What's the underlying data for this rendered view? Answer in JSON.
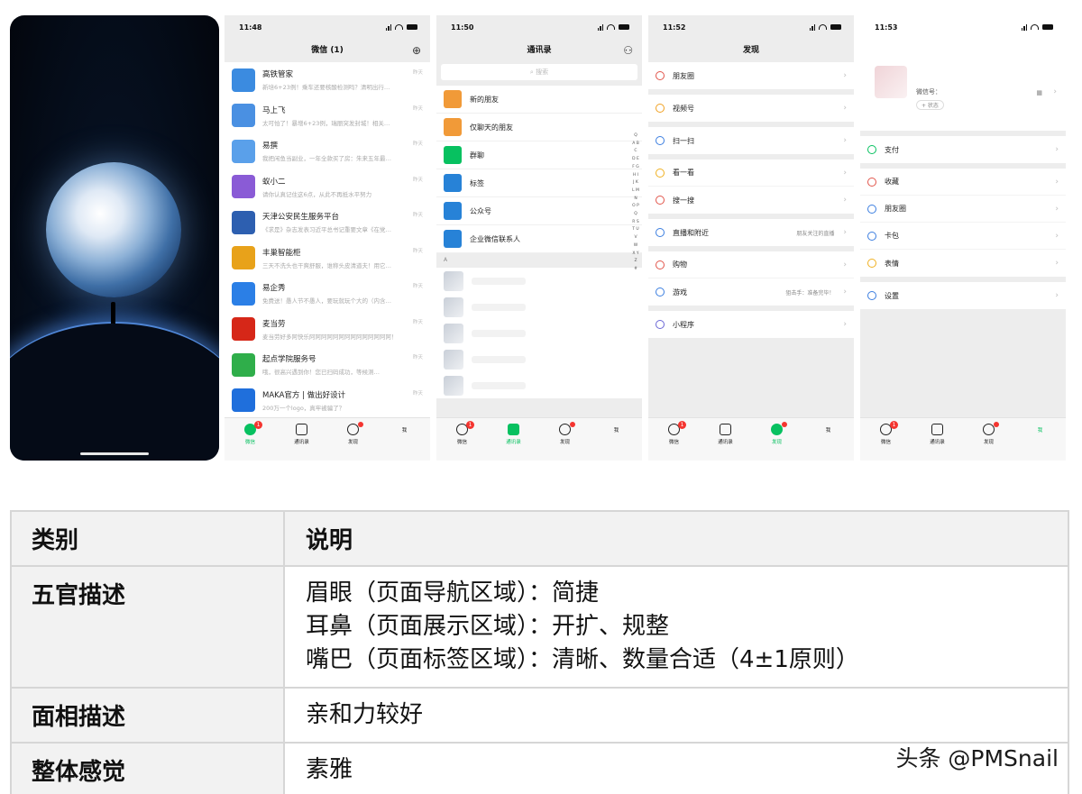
{
  "phone2": {
    "time": "11:48",
    "title": "微信 (1)",
    "chats": [
      {
        "name": "高铁管家",
        "msg": "新培6+23例！乘车还要核酸检测吗？清明出行…",
        "time": "昨天",
        "color": "#3b8be0"
      },
      {
        "name": "马上飞",
        "msg": "太可怕了！暴增6+23例，瑞丽突发封城！相关…",
        "time": "昨天",
        "color": "#4a90e2"
      },
      {
        "name": "易撰",
        "msg": "我把闲鱼当副业，一年全款买了房：朱来五年最…",
        "time": "昨天",
        "color": "#5aa0ea"
      },
      {
        "name": "蚁小二",
        "msg": "请你认真记住这6点，从此不再抵水平努力",
        "time": "昨天",
        "color": "#8a5bd6"
      },
      {
        "name": "天津公安民生服务平台",
        "msg": "《求是》杂志发表习近平总书记重要文章《在党…",
        "time": "昨天",
        "color": "#2d5fb0"
      },
      {
        "name": "丰巢智能柜",
        "msg": "三天不洗头也干爽舒服，谁称头皮清道夫！用它…",
        "time": "昨天",
        "color": "#e8a21a"
      },
      {
        "name": "易企秀",
        "msg": "免费送！愚人节不愚人，要玩就玩个大的（内含…",
        "time": "昨天",
        "color": "#2b7fe6"
      },
      {
        "name": "麦当劳",
        "msg": "麦当劳好多阿快乐阿阿阿阿阿阿阿阿阿阿阿阿阿阿！",
        "time": "昨天",
        "color": "#d62718"
      },
      {
        "name": "起点学院服务号",
        "msg": "哦，很高兴遇到你！您已扫码成功，等候测…",
        "time": "昨天",
        "color": "#2fae4a"
      },
      {
        "name": "MAKA官方 | 做出好设计",
        "msg": "200万一个logo，真牢被骗了？",
        "time": "昨天",
        "color": "#1f6fdc"
      }
    ],
    "tabs": [
      "微信",
      "通讯录",
      "发现",
      "我"
    ],
    "badge": "1"
  },
  "phone3": {
    "time": "11:50",
    "title": "通讯录",
    "search": "搜索",
    "items": [
      {
        "label": "新的朋友",
        "color": "#f19a38"
      },
      {
        "label": "仅聊天的朋友",
        "color": "#f19a38"
      },
      {
        "label": "群聊",
        "color": "#07c160"
      },
      {
        "label": "标签",
        "color": "#2782d7"
      },
      {
        "label": "公众号",
        "color": "#2782d7"
      },
      {
        "label": "企业微信联系人",
        "color": "#2782d7"
      }
    ],
    "section": "A",
    "alpha": "Q A B C D E F G H I J K L M N O P Q R S T U V W X Y Z #"
  },
  "phone4": {
    "time": "11:52",
    "title": "发现",
    "groups": [
      [
        {
          "label": "朋友圈",
          "extra": "",
          "color": "#e2554b"
        }
      ],
      [
        {
          "label": "视频号",
          "extra": "",
          "color": "#f0a020"
        }
      ],
      [
        {
          "label": "扫一扫",
          "extra": "",
          "color": "#3b7ee0"
        }
      ],
      [
        {
          "label": "看一看",
          "extra": "",
          "color": "#f0b020"
        },
        {
          "label": "搜一搜",
          "extra": "",
          "color": "#e2554b"
        }
      ],
      [
        {
          "label": "直播和附近",
          "extra": "朋友关注的直播",
          "color": "#3b7ee0"
        }
      ],
      [
        {
          "label": "购物",
          "extra": "",
          "color": "#e2554b"
        },
        {
          "label": "游戏",
          "extra": "狙击手：准备完毕！",
          "color": "#3b7ee0"
        }
      ],
      [
        {
          "label": "小程序",
          "extra": "",
          "color": "#6b67d6"
        }
      ]
    ]
  },
  "phone5": {
    "time": "11:53",
    "wxid": "微信号：",
    "status": "+ 状态",
    "groups": [
      [
        {
          "label": "支付",
          "color": "#07c160"
        }
      ],
      [
        {
          "label": "收藏",
          "color": "#e2554b"
        },
        {
          "label": "朋友圈",
          "color": "#3b7ee0"
        },
        {
          "label": "卡包",
          "color": "#3b7ee0"
        },
        {
          "label": "表情",
          "color": "#f0b020"
        }
      ],
      [
        {
          "label": "设置",
          "color": "#3b7ee0"
        }
      ]
    ]
  },
  "table": {
    "header": {
      "col1": "类别",
      "col2": "说明"
    },
    "rows": [
      {
        "category": "五官描述",
        "lines": [
          "眉眼（页面导航区域）：简捷",
          "耳鼻（页面展示区域）：开扩、规整",
          "嘴巴（页面标签区域）：清晰、数量合适（4±1原则）"
        ]
      },
      {
        "category": "面相描述",
        "lines": [
          "亲和力较好"
        ]
      },
      {
        "category": "整体感觉",
        "lines": [
          "素雅"
        ]
      }
    ]
  },
  "watermark": "头条 @PMSnail"
}
